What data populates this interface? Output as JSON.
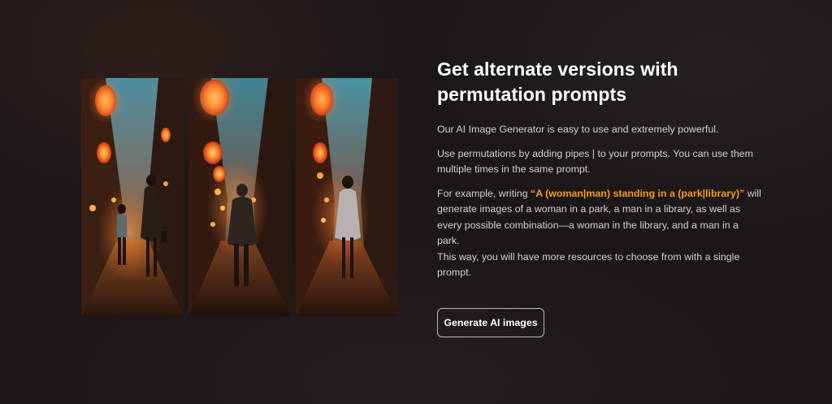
{
  "section": {
    "title": "Get alternate versions with permutation prompts",
    "paragraph1": "Our AI Image Generator is easy to use and extremely powerful.",
    "paragraph2": "Use permutations by adding pipes | to your prompts. You can use them multiple times in the same prompt.",
    "paragraph3_intro": "For example, writing ",
    "paragraph3_prompt": "“A (woman|man) standing in a (park|library)”",
    "paragraph3_body": " will generate images of a woman in a park, a man in a library, as well as every possible combination—a woman in the library, and a man in a park.",
    "paragraph3_closing": "This way, you will have more resources to choose from with a single prompt.",
    "cta_label": "Generate AI images"
  },
  "gallery": {
    "images": [
      {
        "subject": "woman and child walking in lantern-lit alley"
      },
      {
        "subject": "man walking in lantern-lit alley"
      },
      {
        "subject": "woman walking in lantern-lit alley"
      }
    ]
  },
  "colors": {
    "background": "#1b1718",
    "highlight": "#f59a1e",
    "title": "#ffffff",
    "text": "#d2cece"
  }
}
